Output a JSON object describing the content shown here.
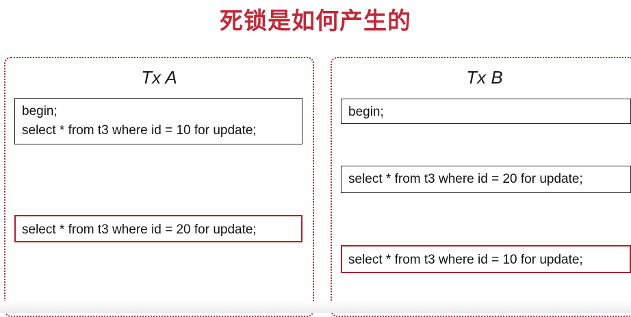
{
  "title": "死锁是如何产生的",
  "tx_a": {
    "label": "Tx A",
    "block1": {
      "line1": "begin;",
      "line2": "select * from t3 where id = 10 for update;"
    },
    "block2": {
      "line1": "select * from t3 where id = 20 for update;"
    }
  },
  "tx_b": {
    "label": "Tx B",
    "block1": {
      "line1": "begin;"
    },
    "block2": {
      "line1": "select * from t3 where id = 20 for update;"
    },
    "block3": {
      "line1": "select * from t3 where id = 10 for update;"
    }
  },
  "colors": {
    "title": "#c0283a",
    "panel_border": "#9e2a3c",
    "highlight_border": "#b01f2e"
  }
}
